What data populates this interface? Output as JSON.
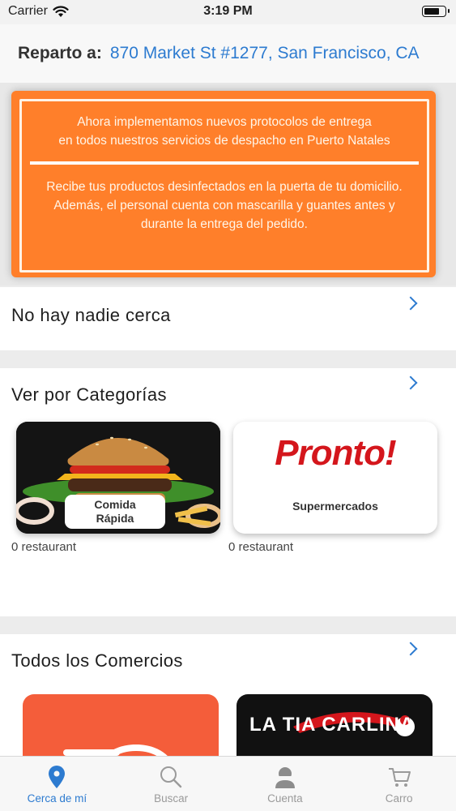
{
  "status_bar": {
    "carrier": "Carrier",
    "time": "3:19 PM",
    "battery_level": 0.8
  },
  "address": {
    "label": "Reparto a:",
    "value": "870 Market St #1277, San Francisco, CA"
  },
  "banner": {
    "line1": "Ahora implementamos nuevos protocolos de entrega",
    "line2": "en todos nuestros servicios de despacho en Puerto Natales",
    "line3": "Recibe tus productos desinfectados en la puerta de tu domicilio.",
    "line4": "Además, el personal cuenta con mascarilla y guantes antes y",
    "line5": "durante la entrega del pedido."
  },
  "nearby": {
    "title": "No hay nadie cerca"
  },
  "categories": {
    "title": "Ver por Categorías",
    "items": [
      {
        "label": "Comida Rápida",
        "count": "0 restaurant",
        "image": "burger"
      },
      {
        "label": "Supermercados",
        "logo_text": "Pronto!",
        "count": "0 restaurant",
        "image": "pronto-logo"
      }
    ]
  },
  "comercios": {
    "title": "Todos los Comercios",
    "items": [
      {
        "logo_text": "",
        "image": "orange-cooking-pot"
      },
      {
        "logo_text": "LA TIA CARLINA",
        "image": "la-tia-carlina-logo"
      }
    ]
  },
  "tab_bar": {
    "items": [
      {
        "label": "Cerca de mí",
        "icon": "location-pin-icon",
        "active": true
      },
      {
        "label": "Buscar",
        "icon": "search-icon",
        "active": false
      },
      {
        "label": "Cuenta",
        "icon": "person-icon",
        "active": false
      },
      {
        "label": "Carro",
        "icon": "cart-icon",
        "active": false
      }
    ]
  },
  "colors": {
    "accent": "#2d7bd0",
    "banner": "#ff7f2a",
    "brand_red": "#d4161c"
  }
}
